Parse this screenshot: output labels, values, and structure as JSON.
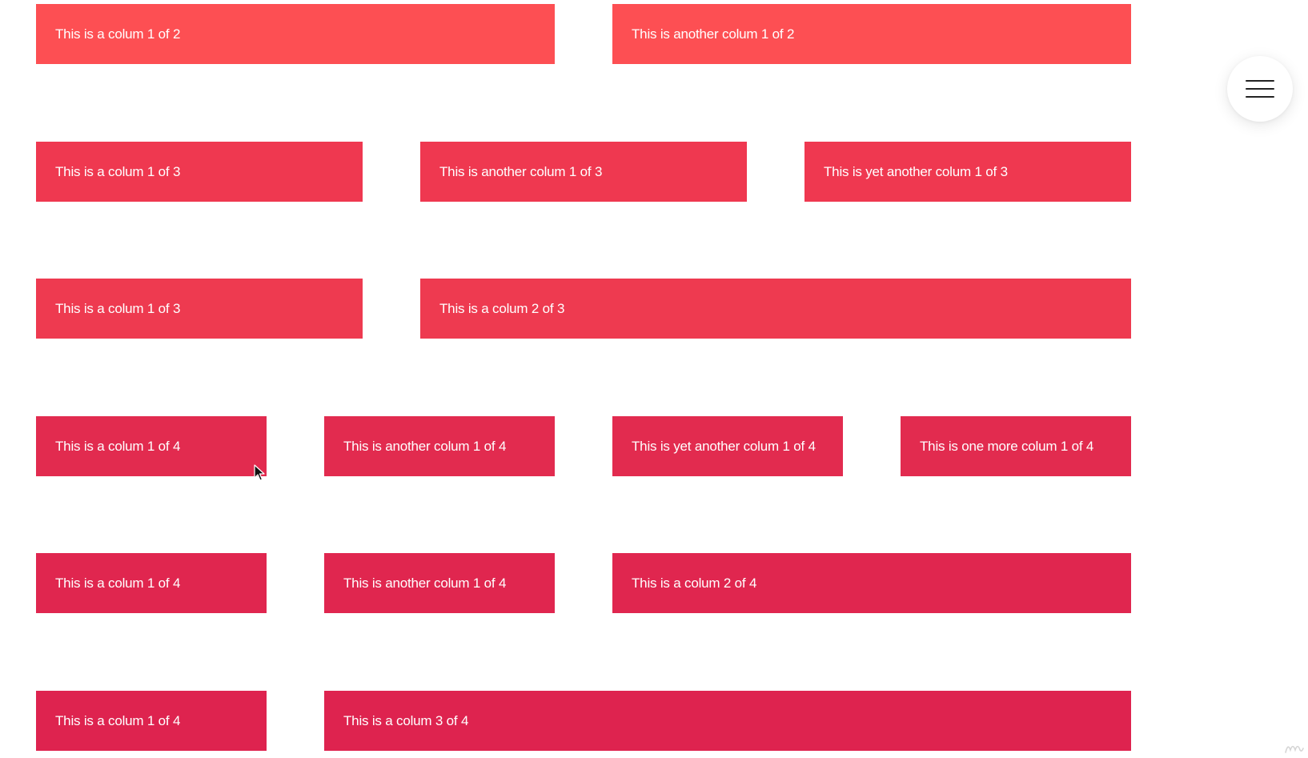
{
  "colors": {
    "row1": "#fd4f53",
    "row2": "#ef3850",
    "row3": "#ee3a50",
    "row4": "#e22b4f",
    "row5": "#e0264f",
    "row6": "#de234f"
  },
  "grid": {
    "row1": [
      "This is a colum 1 of 2",
      "This is another colum 1 of 2"
    ],
    "row2": [
      "This is a colum 1 of 3",
      "This is another colum 1 of 3",
      "This is yet another colum 1 of 3"
    ],
    "row3": [
      "This is a colum 1 of 3",
      "This is a colum 2 of 3"
    ],
    "row4": [
      "This is a colum 1 of 4",
      "This is another colum 1 of 4",
      "This is yet another colum 1 of 4",
      "This is one more colum 1 of 4"
    ],
    "row5": [
      "This is a colum 1 of 4",
      "This is another colum 1 of 4",
      "This is a colum 2 of 4"
    ],
    "row6": [
      "This is a colum 1 of 4",
      "This is a colum 3 of 4"
    ]
  },
  "icons": {
    "menu": "hamburger-icon",
    "cursor": "mouse-pointer-icon",
    "watermark": "logo-watermark-icon"
  }
}
